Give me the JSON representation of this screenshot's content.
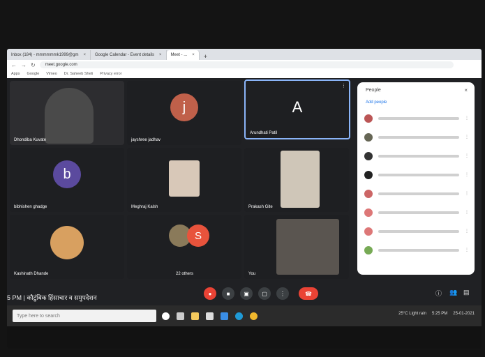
{
  "browser": {
    "tabs": [
      {
        "label": "Inbox (184) - mmmmmmk1999@gm"
      },
      {
        "label": "Google Calendar - Event details"
      },
      {
        "label": "Meet - ..."
      }
    ],
    "url": "meet.google.com",
    "bookmarks": [
      "Apps",
      "Google",
      "Vimeo",
      "Dr. Saheeb Sheti",
      "Privacy error"
    ]
  },
  "meet": {
    "tiles": [
      {
        "name": "Dhondiba Kuvate"
      },
      {
        "name": "jayshree jadhav",
        "initial": "j"
      },
      {
        "name": "Arundhati Patil",
        "initial": "A"
      },
      {
        "name": "bibhishen ghadge",
        "initial": "b"
      },
      {
        "name": "Meghraj Kalsh"
      },
      {
        "name": "Prakash Gite"
      },
      {
        "name": "Kashinath Dhande"
      },
      {
        "name": "22 others",
        "initial": "S"
      },
      {
        "name": "You"
      }
    ],
    "meeting_title": "5 PM | कौटुंबिक हिंसाचार व समुपदेशन"
  },
  "people": {
    "title": "People",
    "add_label": "Add people"
  },
  "taskbar": {
    "search_placeholder": "Type here to search",
    "weather": "25°C Light rain",
    "time": "5:25 PM",
    "date": "25-01-2021"
  },
  "colors": {
    "tile_bg": "#3c4043",
    "avatar_j": "#c0604a",
    "avatar_b": "#5b4a9e",
    "avatar_s": "#e8533c",
    "leave": "#ea4335",
    "speaking": "#8ab4f8"
  },
  "icons": [
    "back-icon",
    "forward-icon",
    "reload-icon",
    "mic-icon",
    "camera-icon",
    "captions-icon",
    "present-icon",
    "more-icon",
    "leave-call-icon",
    "info-icon",
    "people-icon",
    "chat-icon"
  ]
}
